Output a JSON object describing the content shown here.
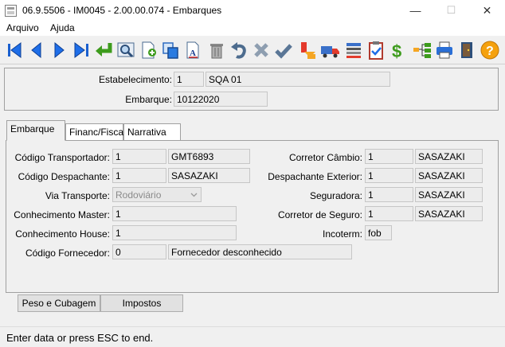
{
  "window": {
    "title": "06.9.5506 - IM0045 - 2.00.00.074 - Embarques",
    "minimize_glyph": "—",
    "maximize_glyph": "☐",
    "close_glyph": "✕"
  },
  "menu": [
    "Arquivo",
    "Ajuda"
  ],
  "toolbar": {
    "icons": [
      "first-record-icon",
      "previous-record-icon",
      "next-record-icon",
      "last-record-icon",
      "goto-icon",
      "search-icon",
      "new-record-icon",
      "copy-icon",
      "edit-icon",
      "delete-icon",
      "undo-icon",
      "cancel-icon",
      "confirm-icon",
      "process-icon",
      "truck-icon",
      "list-icon",
      "clipboard-icon",
      "money-icon",
      "tree-icon",
      "print-icon",
      "exit-door-icon",
      "help-icon"
    ]
  },
  "header": {
    "estabelecimento_label": "Estabelecimento:",
    "estabelecimento_code": "1",
    "estabelecimento_name": "SQA 01",
    "embarque_label": "Embarque:",
    "embarque_value": "10122020"
  },
  "tabs": [
    "Embarque",
    "Financ/Fisca",
    "Narrativa"
  ],
  "form": {
    "cod_transportador_label": "Código Transportador:",
    "cod_transportador": "1",
    "transportador_name": "GMT6893",
    "cod_despachante_label": "Código Despachante:",
    "cod_despachante": "1",
    "despachante_name": "SASAZAKI",
    "via_transporte_label": "Via Transporte:",
    "via_transporte": "Rodoviário",
    "conhecimento_master_label": "Conhecimento Master:",
    "conhecimento_master": "1",
    "conhecimento_house_label": "Conhecimento House:",
    "conhecimento_house": "1",
    "cod_fornecedor_label": "Código Fornecedor:",
    "cod_fornecedor": "0",
    "fornecedor_name": "Fornecedor desconhecido",
    "corretor_cambio_label": "Corretor Câmbio:",
    "corretor_cambio": "1",
    "corretor_cambio_name": "SASAZAKI",
    "despachante_exterior_label": "Despachante Exterior:",
    "despachante_exterior": "1",
    "despachante_exterior_name": "SASAZAKI",
    "seguradora_label": "Seguradora:",
    "seguradora": "1",
    "seguradora_name": "SASAZAKI",
    "corretor_seguro_label": "Corretor de Seguro:",
    "corretor_seguro": "1",
    "corretor_seguro_name": "SASAZAKI",
    "incoterm_label": "Incoterm:",
    "incoterm": "fob"
  },
  "buttons": {
    "peso_cubagem": "Peso e Cubagem",
    "impostos": "Impostos"
  },
  "status": "Enter data or press ESC to end."
}
